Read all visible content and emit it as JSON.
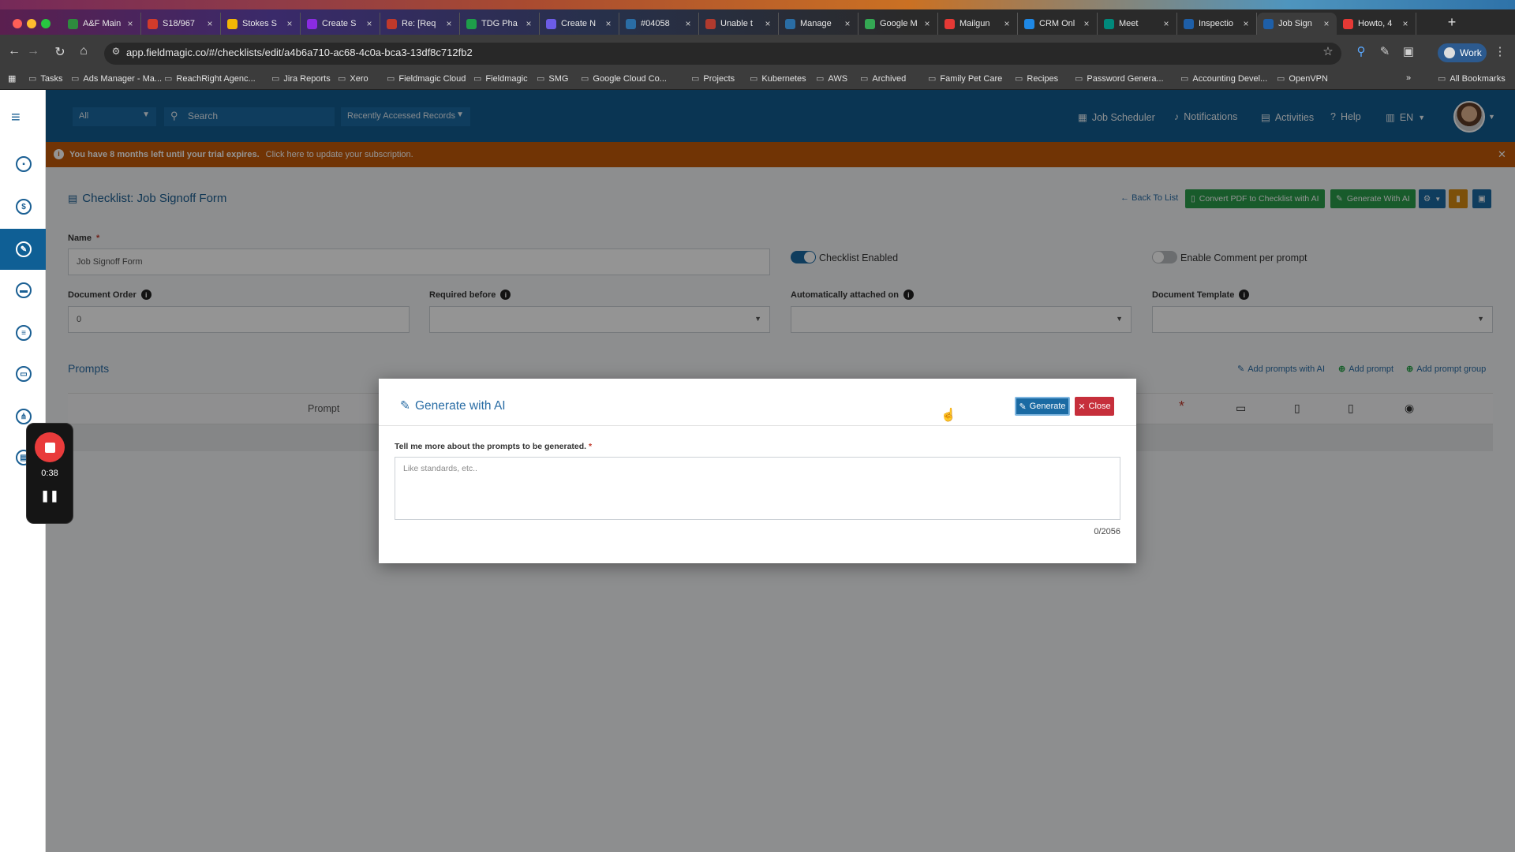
{
  "browser": {
    "tabs": [
      {
        "label": "A&F Main",
        "color": "#2e8b3e"
      },
      {
        "label": "S18/967",
        "color": "#d23b2b"
      },
      {
        "label": "Stokes S",
        "color": "#f2b705"
      },
      {
        "label": "Create S",
        "color": "#8a2be2"
      },
      {
        "label": "Re: [Req",
        "color": "#c0392b"
      },
      {
        "label": "TDG Pha",
        "color": "#1e9e4a"
      },
      {
        "label": "Create N",
        "color": "#6c5ce7"
      },
      {
        "label": "#04058",
        "color": "#2a6da5"
      },
      {
        "label": "Unable t",
        "color": "#b03a2e"
      },
      {
        "label": "Manage",
        "color": "#2a6da5"
      },
      {
        "label": "Google M",
        "color": "#34a853"
      },
      {
        "label": "Mailgun",
        "color": "#e53935"
      },
      {
        "label": "CRM Onl",
        "color": "#1e88e5"
      },
      {
        "label": "Meet",
        "color": "#00897b"
      },
      {
        "label": "Inspectio",
        "color": "#1e5fa8"
      },
      {
        "label": "Job Sign",
        "color": "#1e5fa8"
      },
      {
        "label": "Howto, 4",
        "color": "#e53935"
      }
    ],
    "active_tab_index": 15,
    "url": "app.fieldmagic.co/#/checklists/edit/a4b6a710-ac68-4c0a-bca3-13df8c712fb2",
    "profile_label": "Work",
    "bookmarks": [
      "Tasks",
      "Ads Manager - Ma...",
      "ReachRight Agenc...",
      "Jira Reports",
      "Xero",
      "Fieldmagic Cloud",
      "Fieldmagic",
      "SMG",
      "Google Cloud Co...",
      "Projects",
      "Kubernetes",
      "AWS",
      "Archived",
      "Family Pet Care",
      "Recipes",
      "Password Genera...",
      "Accounting Devel...",
      "OpenVPN"
    ],
    "all_bookmarks_label": "All Bookmarks"
  },
  "topbar": {
    "scope_value": "All",
    "search_placeholder": "Search",
    "recent_label": "Recently Accessed Records",
    "nav": {
      "job_scheduler": "Job Scheduler",
      "notifications": "Notifications",
      "activities": "Activities",
      "help": "Help",
      "language": "EN"
    }
  },
  "trial": {
    "message": "You have 8 months left until your trial expires.",
    "link": "Click here to update your subscription."
  },
  "page": {
    "title": "Checklist: Job Signoff Form",
    "back_to_list": "Back To List",
    "convert_pdf": "Convert PDF to Checklist with AI",
    "generate_with_ai": "Generate With AI",
    "name_label": "Name",
    "name_value": "Job Signoff Form",
    "checklist_enabled_label": "Checklist Enabled",
    "checklist_enabled": true,
    "comment_per_prompt_label": "Enable Comment per prompt",
    "comment_per_prompt": false,
    "document_order_label": "Document Order",
    "document_order_value": "0",
    "required_before_label": "Required before",
    "auto_attached_label": "Automatically attached on",
    "document_template_label": "Document Template",
    "prompts_title": "Prompts",
    "add_prompts_ai": "Add prompts with AI",
    "add_prompt": "Add prompt",
    "add_prompt_group": "Add prompt group",
    "col_prompt": "Prompt"
  },
  "modal": {
    "title": "Generate with AI",
    "generate_label": "Generate",
    "close_label": "Close",
    "field_label": "Tell me more about the prompts to be generated.",
    "placeholder": "Like standards, etc..",
    "char_count": "0/2056"
  },
  "recorder": {
    "elapsed": "0:38"
  },
  "colors": {
    "brand_blue": "#125c90",
    "trial_orange": "#c35a0a",
    "ai_green": "#2a9d4a",
    "danger_red": "#c62f3b"
  }
}
